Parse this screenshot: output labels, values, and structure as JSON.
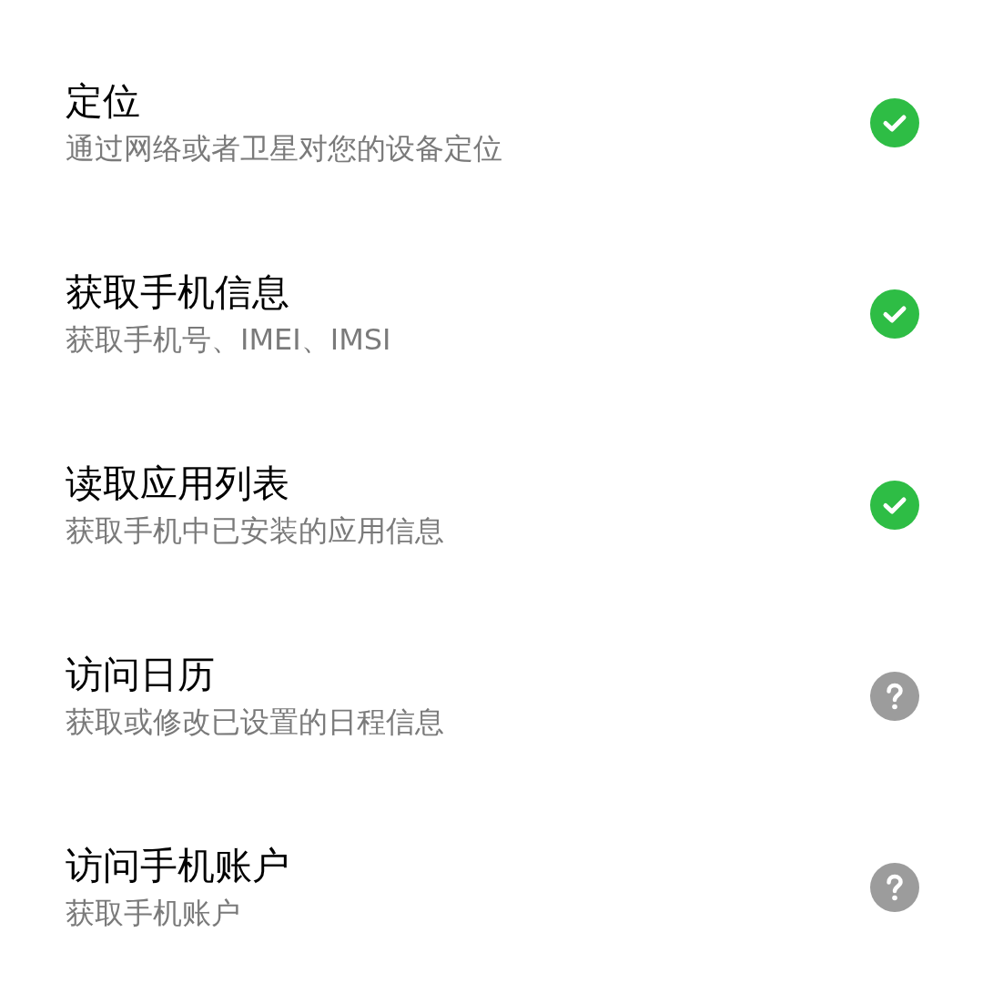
{
  "permissions": [
    {
      "title": "定位",
      "description": "通过网络或者卫星对您的设备定位",
      "granted": true
    },
    {
      "title": "获取手机信息",
      "description": "获取手机号、IMEI、IMSI",
      "granted": true
    },
    {
      "title": "读取应用列表",
      "description": "获取手机中已安装的应用信息",
      "granted": true
    },
    {
      "title": "访问日历",
      "description": "获取或修改已设置的日程信息",
      "granted": false
    },
    {
      "title": "访问手机账户",
      "description": "获取手机账户",
      "granted": false
    }
  ]
}
